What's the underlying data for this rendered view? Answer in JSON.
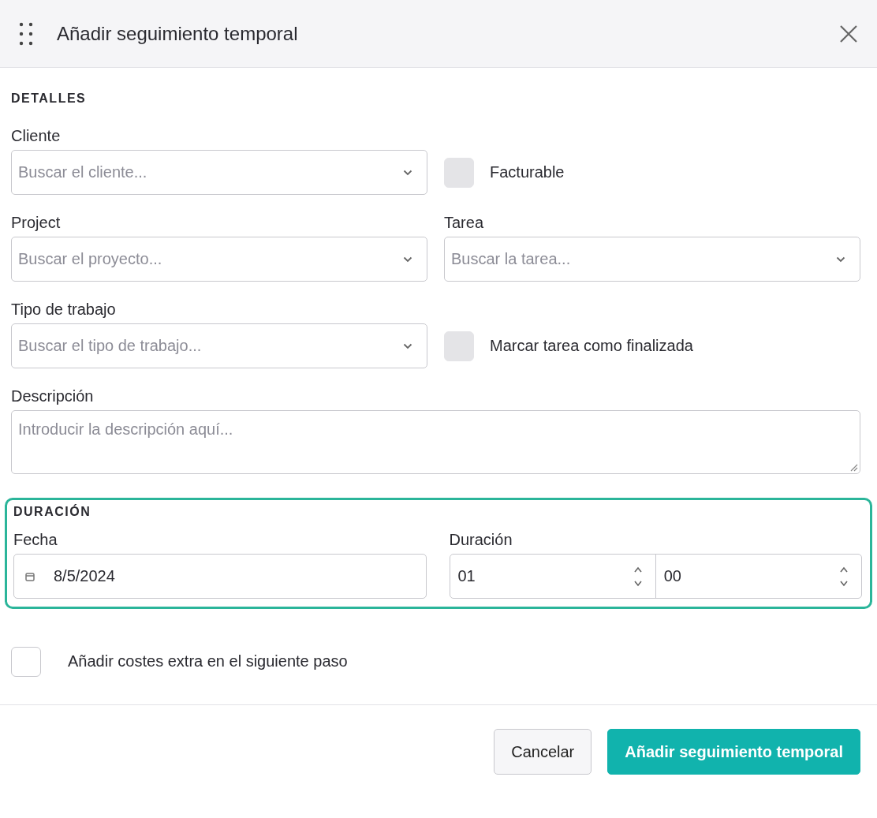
{
  "dialog": {
    "title": "Añadir seguimiento temporal"
  },
  "details": {
    "heading": "DETALLES",
    "fields": [
      {
        "kind": "select",
        "label": "Cliente",
        "placeholder": "Buscar el cliente..."
      },
      {
        "kind": "checkbox",
        "label": "Facturable",
        "checked": false,
        "disabled": true
      },
      {
        "kind": "select",
        "label": "Project",
        "placeholder": "Buscar el proyecto..."
      },
      {
        "kind": "select",
        "label": "Tarea",
        "placeholder": "Buscar la tarea..."
      },
      {
        "kind": "select",
        "label": "Tipo de trabajo",
        "placeholder": "Buscar el tipo de trabajo..."
      },
      {
        "kind": "checkbox",
        "label": "Marcar tarea como finalizada",
        "checked": false,
        "disabled": true
      },
      {
        "kind": "textarea",
        "label": "Descripción",
        "placeholder": "Introducir la descripción aquí..."
      }
    ]
  },
  "duration_section": {
    "heading": "DURACIÓN",
    "highlighted": true,
    "date": {
      "label": "Fecha",
      "value": "8/5/2024"
    },
    "duration": {
      "label": "Duración",
      "hours": "01",
      "minutes": "00"
    }
  },
  "extra_costs": {
    "label": "Añadir costes extra en el siguiente paso",
    "checked": false,
    "disabled": false
  },
  "buttons": [
    {
      "label": "Cancelar",
      "kind": "secondary"
    },
    {
      "label": "Añadir seguimiento temporal",
      "kind": "primary"
    }
  ]
}
